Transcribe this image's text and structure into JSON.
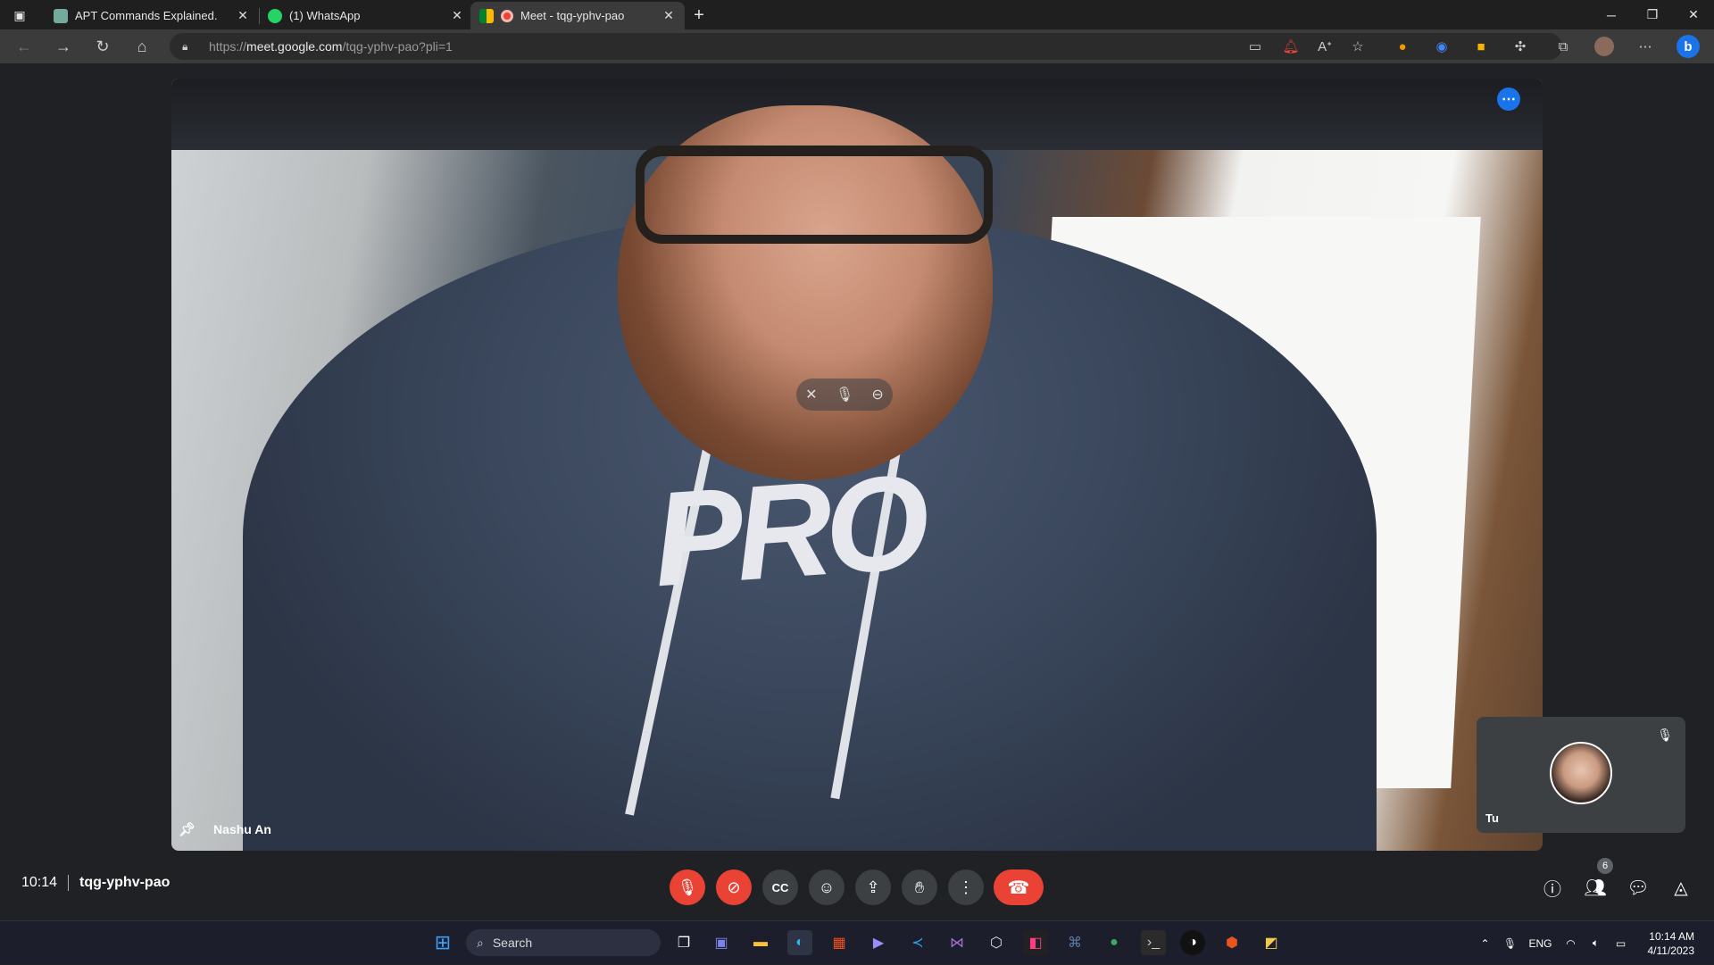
{
  "browser": {
    "tabs": [
      {
        "title": "APT Commands Explained.",
        "icon": "chatgpt-icon",
        "color": "#74aa9c",
        "active": false
      },
      {
        "title": "(1) WhatsApp",
        "icon": "whatsapp-icon",
        "color": "#25d366",
        "active": false
      },
      {
        "title": "Meet - tqg-yphv-pao",
        "icon": "meet-icon",
        "color": "#00832d",
        "active": true
      }
    ],
    "url_prefix": "https://",
    "url_domain": "meet.google.com",
    "url_path": "/tqg-yphv-pao?pli=1"
  },
  "meet": {
    "main_participant": {
      "name": "Nashu An",
      "hoodie_text": "PRO"
    },
    "self_tile": {
      "name": "Tu"
    },
    "clock": "10:14",
    "meeting_code": "tqg-yphv-pao",
    "people_count": "6",
    "controls": [
      {
        "name": "microphone-off",
        "icon": "mic-off-icon",
        "color": "#ea4335"
      },
      {
        "name": "camera-off",
        "icon": "camera-off-icon",
        "color": "#ea4335"
      },
      {
        "name": "captions",
        "icon": "captions-icon"
      },
      {
        "name": "reactions",
        "icon": "emoji-icon"
      },
      {
        "name": "present",
        "icon": "present-screen-icon"
      },
      {
        "name": "raise-hand",
        "icon": "hand-icon"
      },
      {
        "name": "more-options",
        "icon": "more-vertical-icon"
      }
    ],
    "side_controls": [
      "info-icon",
      "people-icon",
      "chat-icon",
      "activities-icon"
    ]
  },
  "taskbar": {
    "search_label": "Search",
    "language": "ENG",
    "time": "10:14 AM",
    "date": "4/11/2023"
  },
  "colors": {
    "accent": "#1a73e8",
    "danger": "#ea4335",
    "meet_bg": "#202124",
    "control_bg": "#3c4043"
  }
}
